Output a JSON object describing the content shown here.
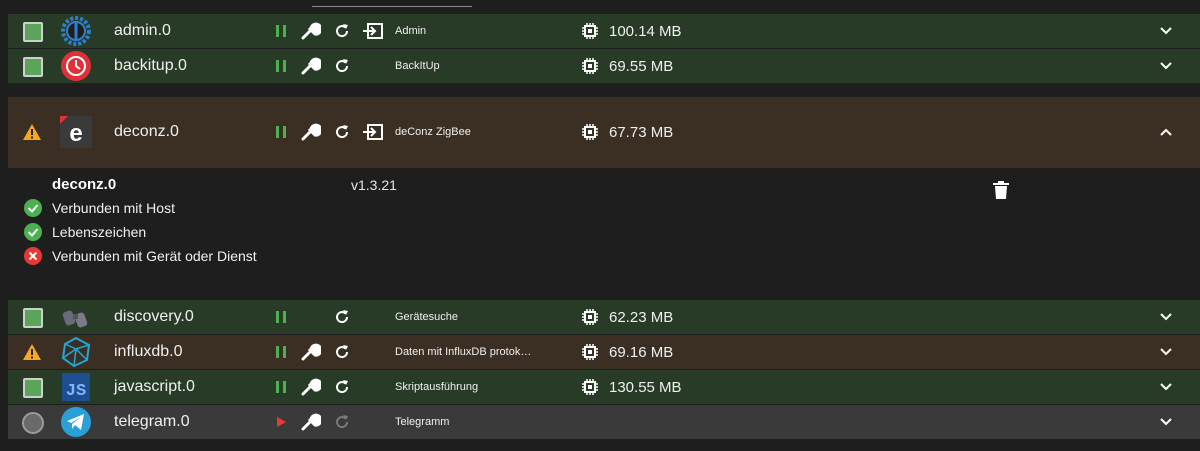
{
  "colors": {
    "ok": "#4caf50",
    "warning": "#f6a623",
    "error": "#e53935",
    "running": "#4caf50",
    "stopped": "#e53935",
    "row_green": "#273b26",
    "row_brown": "#3a2f22",
    "row_gray": "#3a3a3a"
  },
  "adapters": [
    {
      "name": "admin.0",
      "title": "Admin",
      "memory": "100.14 MB",
      "status": "ok",
      "icon": "admin-gear-icon",
      "state": "running",
      "has_settings": true,
      "has_link": true,
      "expanded": false
    },
    {
      "name": "backitup.0",
      "title": "BackItUp",
      "memory": "69.55 MB",
      "status": "ok",
      "icon": "backitup-clock-icon",
      "state": "running",
      "has_settings": true,
      "has_link": false,
      "expanded": false
    },
    {
      "name": "deconz.0",
      "title": "deConz ZigBee",
      "memory": "67.73 MB",
      "status": "warning",
      "icon": "deconz-e-icon",
      "state": "running",
      "has_settings": true,
      "has_link": true,
      "expanded": true
    },
    {
      "name": "discovery.0",
      "title": "Gerätesuche",
      "memory": "62.23 MB",
      "status": "ok",
      "icon": "discovery-binoculars-icon",
      "state": "running",
      "has_settings": false,
      "has_link": false,
      "expanded": false
    },
    {
      "name": "influxdb.0",
      "title": "Daten mit InfluxDB protok…",
      "memory": "69.16 MB",
      "status": "warning",
      "icon": "influxdb-cube-icon",
      "state": "running",
      "has_settings": true,
      "has_link": false,
      "expanded": false
    },
    {
      "name": "javascript.0",
      "title": "Skriptausführung",
      "memory": "130.55 MB",
      "status": "ok",
      "icon": "javascript-js-icon",
      "state": "running",
      "has_settings": true,
      "has_link": false,
      "expanded": false
    },
    {
      "name": "telegram.0",
      "title": "Telegramm",
      "memory": "",
      "status": "off",
      "icon": "telegram-plane-icon",
      "state": "stopped",
      "has_settings": true,
      "has_link": false,
      "expanded": false
    }
  ],
  "details": {
    "title": "deconz.0",
    "version": "v1.3.21",
    "checks": [
      {
        "label": "Verbunden mit Host",
        "ok": true
      },
      {
        "label": "Lebenszeichen",
        "ok": true
      },
      {
        "label": "Verbunden mit Gerät oder Dienst",
        "ok": false
      }
    ]
  }
}
